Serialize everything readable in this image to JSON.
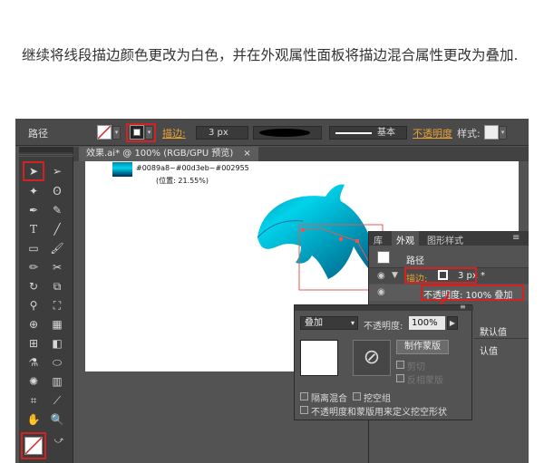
{
  "caption": "继续将线段描边颜色更改为白色，并在外观属性面板将描边混合属性更改为叠加.",
  "colors": {
    "accent_red": "#d22222",
    "ui_dark": "#535353",
    "dolphin_top": "#0089a8",
    "dolphin_mid": "#00d3eb",
    "dolphin_bottom": "#002955"
  },
  "control_bar": {
    "object_type": "路径",
    "stroke_label": "描边:",
    "stroke_weight": "3 px",
    "profile_label": "基本",
    "opacity_label": "不透明度",
    "style_label": "样式:"
  },
  "document_tab": {
    "title": "效果.ai* @ 100% (RGB/GPU 预览)",
    "close": "×"
  },
  "gradient_info": {
    "stops": "#0089a8~#00d3eb~#002955",
    "position": "(位置: 21.55%)"
  },
  "library_panel": {
    "tabs": [
      "库",
      "外观",
      "图形样式"
    ],
    "menu_icon": "≡",
    "rows": {
      "path": "路径",
      "stroke_label": "描边:",
      "stroke_value": "3 px *",
      "opacity_value": "不透明度: 100% 叠加",
      "default_1": "默认值",
      "default_2": "认值"
    }
  },
  "transparency_panel": {
    "blend_mode": "叠加",
    "opacity_label": "不透明度:",
    "opacity_value": "100%",
    "make_mask": "制作蒙版",
    "clip": "剪切",
    "invert_mask": "反相蒙版",
    "isolate_blending": "隔离混合",
    "knockout_group": "挖空组",
    "opacity_mask_knockout": "不透明度和蒙版用来定义挖空形状"
  },
  "tools": {
    "selection": "selection-arrow",
    "direct_selection": "direct-selection-arrow"
  }
}
